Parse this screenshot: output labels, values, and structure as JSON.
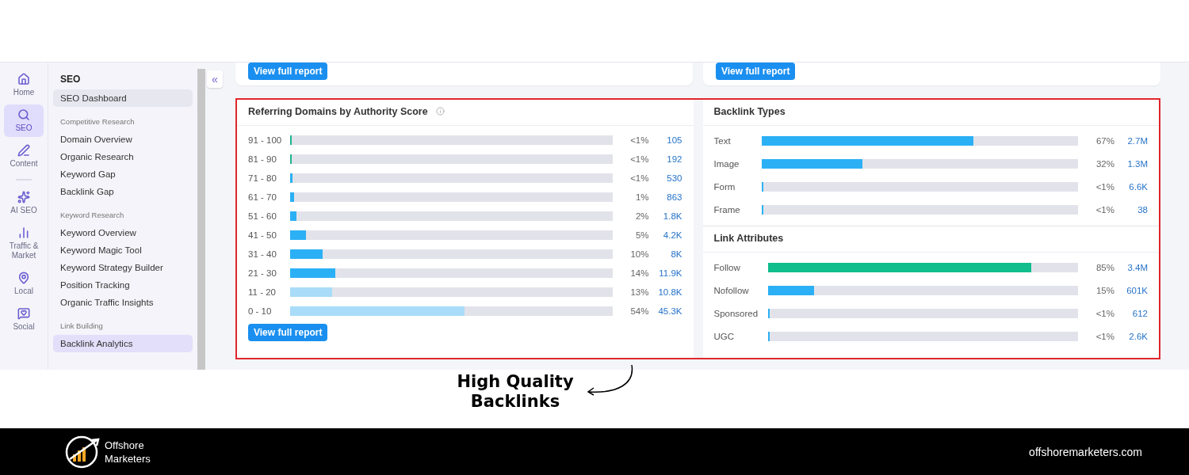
{
  "rail": [
    {
      "kind": "item",
      "label": "Home",
      "selected": false
    },
    {
      "kind": "item",
      "label": "SEO",
      "selected": true
    },
    {
      "kind": "item",
      "label": "Content",
      "selected": false
    },
    {
      "kind": "divider"
    },
    {
      "kind": "item",
      "label": "AI SEO",
      "selected": false
    },
    {
      "kind": "item",
      "label": "Traffic & Market",
      "selected": false
    },
    {
      "kind": "item",
      "label": "Local",
      "selected": false
    },
    {
      "kind": "item",
      "label": "Social",
      "selected": false
    }
  ],
  "nav": {
    "title": "SEO",
    "items": [
      {
        "kind": "link",
        "label": "SEO Dashboard",
        "selected": true
      },
      {
        "kind": "heading",
        "label": "Competitive Research"
      },
      {
        "kind": "link",
        "label": "Domain Overview",
        "selected": false
      },
      {
        "kind": "link",
        "label": "Organic Research",
        "selected": false
      },
      {
        "kind": "link",
        "label": "Keyword Gap",
        "selected": false
      },
      {
        "kind": "link",
        "label": "Backlink Gap",
        "selected": false
      },
      {
        "kind": "heading",
        "label": "Keyword Research"
      },
      {
        "kind": "link",
        "label": "Keyword Overview",
        "selected": false
      },
      {
        "kind": "link",
        "label": "Keyword Magic Tool",
        "selected": false
      },
      {
        "kind": "link",
        "label": "Keyword Strategy Builder",
        "selected": false
      },
      {
        "kind": "link",
        "label": "Position Tracking",
        "selected": false
      },
      {
        "kind": "link",
        "label": "Organic Traffic Insights",
        "selected": false
      },
      {
        "kind": "heading",
        "label": "Link Building"
      },
      {
        "kind": "link",
        "label": "Backlink Analytics",
        "selected": true
      }
    ]
  },
  "collapse_button": "«",
  "top_cards": [
    {
      "button": "View full report"
    },
    {
      "button": "View full report"
    }
  ],
  "authority": {
    "title": "Referring Domains by Authority Score",
    "rows": [
      {
        "label": "91 - 100",
        "level": 0.004,
        "color": "#1fb58f",
        "percent": "<1%",
        "count": "105"
      },
      {
        "label": "81 - 90",
        "level": 0.004,
        "color": "#1fb58f",
        "percent": "<1%",
        "count": "192"
      },
      {
        "label": "71 - 80",
        "level": 0.008,
        "color": "#2bb0f5",
        "percent": "<1%",
        "count": "530"
      },
      {
        "label": "61 - 70",
        "level": 0.012,
        "color": "#2bb0f5",
        "percent": "1%",
        "count": "863"
      },
      {
        "label": "51 - 60",
        "level": 0.02,
        "color": "#2bb0f5",
        "percent": "2%",
        "count": "1.8K"
      },
      {
        "label": "41 - 50",
        "level": 0.05,
        "color": "#2bb0f5",
        "percent": "5%",
        "count": "4.2K"
      },
      {
        "label": "31 - 40",
        "level": 0.1,
        "color": "#2bb0f5",
        "percent": "10%",
        "count": "8K"
      },
      {
        "label": "21 - 30",
        "level": 0.14,
        "color": "#2bb0f5",
        "percent": "14%",
        "count": "11.9K"
      },
      {
        "label": "11 - 20",
        "level": 0.13,
        "color": "#a9dcf8",
        "percent": "13%",
        "count": "10.8K"
      },
      {
        "label": "0 - 10",
        "level": 0.54,
        "color": "#a9dcf8",
        "percent": "54%",
        "count": "45.3K"
      }
    ],
    "button": "View full report"
  },
  "backlink_types": {
    "title": "Backlink Types",
    "rows": [
      {
        "label": "Text",
        "level": 0.67,
        "color": "#2bb0f5",
        "percent": "67%",
        "count": "2.7M"
      },
      {
        "label": "Image",
        "level": 0.32,
        "color": "#2bb0f5",
        "percent": "32%",
        "count": "1.3M"
      },
      {
        "label": "Form",
        "level": 0.003,
        "color": "#2bb0f5",
        "percent": "<1%",
        "count": "6.6K"
      },
      {
        "label": "Frame",
        "level": 0.003,
        "color": "#2bb0f5",
        "percent": "<1%",
        "count": "38"
      }
    ]
  },
  "link_attributes": {
    "title": "Link Attributes",
    "rows": [
      {
        "label": "Follow",
        "level": 0.85,
        "color": "#10bd8c",
        "percent": "85%",
        "count": "3.4M"
      },
      {
        "label": "Nofollow",
        "level": 0.15,
        "color": "#2bb0f5",
        "percent": "15%",
        "count": "601K"
      },
      {
        "label": "Sponsored",
        "level": 0.003,
        "color": "#2bb0f5",
        "percent": "<1%",
        "count": "612"
      },
      {
        "label": "UGC",
        "level": 0.003,
        "color": "#2bb0f5",
        "percent": "<1%",
        "count": "2.6K"
      }
    ]
  },
  "annotation": "High Quality Backlinks",
  "footer": {
    "brand_line_1": "Offshore",
    "brand_line_2": "Marketers",
    "website": "offshoremarketers.com"
  }
}
